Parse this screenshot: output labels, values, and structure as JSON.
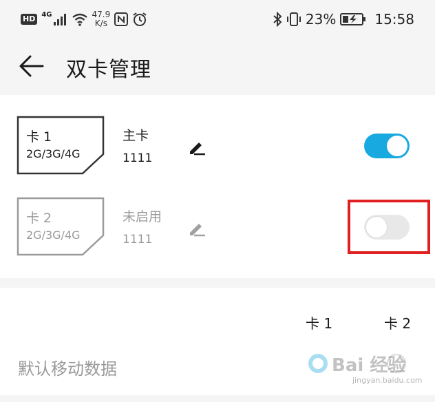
{
  "status_bar": {
    "hd": "HD",
    "net_type": "4G",
    "speed_value": "47.9",
    "speed_unit": "K/s",
    "battery": "23%",
    "time": "15:58"
  },
  "header": {
    "title": "双卡管理"
  },
  "sim_cards": [
    {
      "name": "卡 1",
      "tech": "2G/3G/4G",
      "role": "主卡",
      "number": "1111",
      "enabled": true
    },
    {
      "name": "卡 2",
      "tech": "2G/3G/4G",
      "role": "未启用",
      "number": "1111",
      "enabled": false
    }
  ],
  "default_data": {
    "label": "默认移动数据",
    "col1": "卡 1",
    "col2": "卡 2",
    "selected": "卡 1"
  },
  "watermark": {
    "text": "Bai 经验",
    "sub": "jingyan.baidu.com"
  },
  "colors": {
    "accent": "#17a9df",
    "highlight": "#e02020"
  }
}
